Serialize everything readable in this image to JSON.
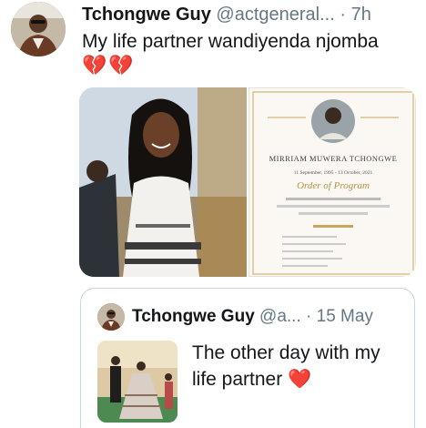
{
  "tweet": {
    "display_name": "Tchongwe Guy",
    "handle": "@actgeneral...",
    "separator": "·",
    "time": "7h",
    "text": "My life partner wandiyenda njomba",
    "emojis": [
      "💔",
      "💔"
    ]
  },
  "media": {
    "program": {
      "name": "MIRRIAM MUWERA TCHONGWE",
      "dates": "11 September, 1995 - 13 October, 2021",
      "heading": "Order of Program"
    }
  },
  "quoted_tweet": {
    "display_name": "Tchongwe Guy",
    "handle": "@a...",
    "separator": "·",
    "date": "15 May",
    "text": "The other day with my life partner",
    "emoji": "❤️"
  },
  "colors": {
    "text": "#14171a",
    "secondary": "#657786",
    "border": "#ccd6dd",
    "heart": "#e0245e"
  }
}
